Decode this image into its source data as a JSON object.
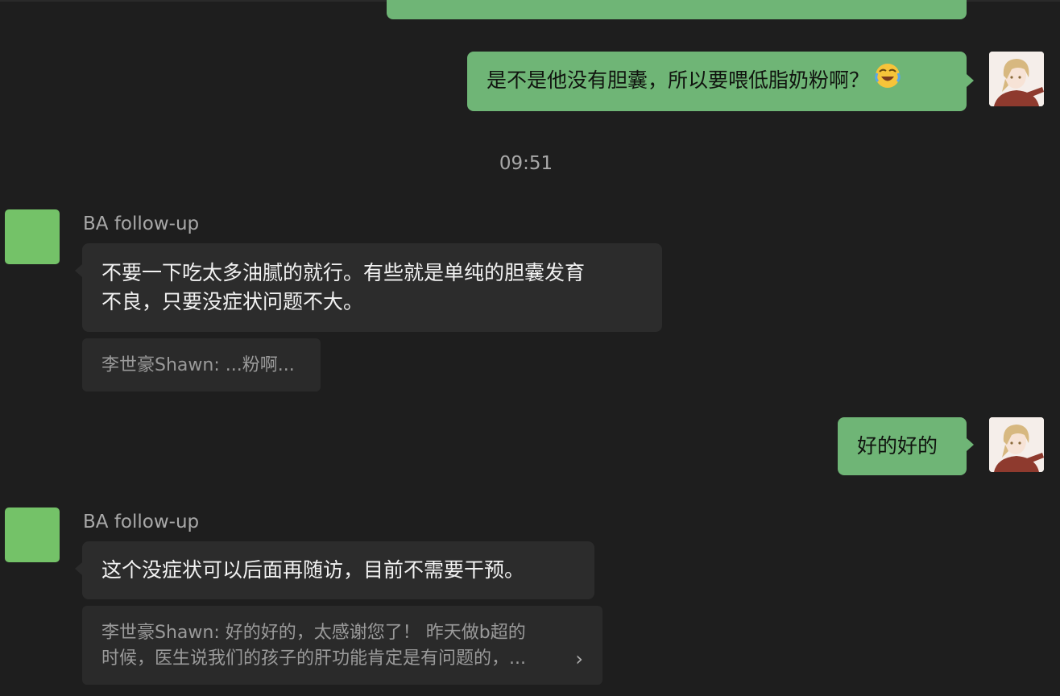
{
  "timestamp": "09:51",
  "messages": {
    "self_1": {
      "text": "是不是他没有胆囊，所以要喂低脂奶粉啊？",
      "emoji": "face-with-tears-of-joy-emoji"
    },
    "ba_1": {
      "sender": "BA follow-up",
      "line1": "不要一下吃太多油腻的就行。有些就是单纯的胆囊发育",
      "line2": "不良，只要没症状问题不大。",
      "quote": "李世豪Shawn: ...粉啊..."
    },
    "self_2": {
      "text": "好的好的"
    },
    "ba_2": {
      "sender": "BA follow-up",
      "text": "这个没症状可以后面再随访，目前不需要干预。",
      "quote_line1": "李世豪Shawn: 好的好的，太感谢您了！ 昨天做b超的",
      "quote_line2": "时候，医生说我们的孩子的肝功能肯定是有问题的，...",
      "quote_chevron": "›"
    }
  },
  "colors": {
    "background": "#1e1e1e",
    "outgoing_bubble": "#6fb576",
    "incoming_bubble": "#2c2c2c",
    "quote_box": "#2a2a2a",
    "ba_avatar": "#74c268"
  }
}
